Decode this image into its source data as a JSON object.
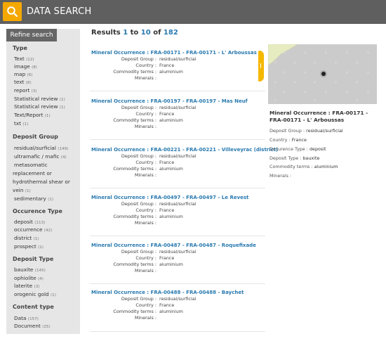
{
  "header": {
    "title": "DATA SEARCH"
  },
  "sidebar": {
    "refine_label": "Refine search",
    "facets": [
      {
        "title": "Type",
        "items": [
          {
            "label": "Text",
            "count": "(12)"
          },
          {
            "label": "image",
            "count": "(8)"
          },
          {
            "label": "map",
            "count": "(6)"
          },
          {
            "label": "text",
            "count": "(8)"
          },
          {
            "label": "report",
            "count": "(3)"
          },
          {
            "label": "Statistical review",
            "count": "(1)"
          },
          {
            "label": "Statistical review",
            "count": "(1)"
          },
          {
            "label": "Text/Report",
            "count": "(1)"
          },
          {
            "label": "txt",
            "count": "(1)"
          }
        ]
      },
      {
        "title": "Deposit Group",
        "items": [
          {
            "label": "residual/surficial",
            "count": "(149)"
          },
          {
            "label": "ultramafic / mafic",
            "count": "(4)"
          },
          {
            "label": "metasomatic",
            "count": ""
          },
          {
            "label": "replacement or",
            "count": ""
          },
          {
            "label": "hydrothermal shear or",
            "count": ""
          },
          {
            "label": "vein",
            "count": "(1)"
          },
          {
            "label": "sedimentary",
            "count": "(1)"
          }
        ]
      },
      {
        "title": "Occurence Type",
        "items": [
          {
            "label": "deposit",
            "count": "(113)"
          },
          {
            "label": "occurrence",
            "count": "(42)"
          },
          {
            "label": "district",
            "count": "(1)"
          },
          {
            "label": "prospect",
            "count": "(1)"
          }
        ]
      },
      {
        "title": "Deposit Type",
        "items": [
          {
            "label": "bauxite",
            "count": "(145)"
          },
          {
            "label": "ophiolite",
            "count": "(4)"
          },
          {
            "label": "laterite",
            "count": "(3)"
          },
          {
            "label": "orogenic gold",
            "count": "(1)"
          }
        ]
      },
      {
        "title": "Content type",
        "items": [
          {
            "label": "Data",
            "count": "(157)"
          },
          {
            "label": "Document",
            "count": "(25)"
          }
        ]
      }
    ]
  },
  "results_header": {
    "prefix": "Results ",
    "from": "1",
    "to_word": " to ",
    "to": "10",
    "of_word": " of ",
    "total": "182"
  },
  "field_labels": {
    "deposit_group": "Deposit Group :",
    "country": "Country :",
    "commodity": "Commodity terms :",
    "minerals": "Minerals :"
  },
  "results": [
    {
      "title": "Mineral Occurrence : FRA-00171 - FRA-00171 - L' Arboussas",
      "deposit_group": "residual/surficial",
      "country": "France",
      "commodity": "aluminium",
      "minerals": ""
    },
    {
      "title": "Mineral Occurrence : FRA-00197 - FRA-00197 - Mas Neuf",
      "deposit_group": "residual/surficial",
      "country": "France",
      "commodity": "aluminium",
      "minerals": ""
    },
    {
      "title": "Mineral Occurrence : FRA-00221 - FRA-00221 - Villeveyrac (district)",
      "deposit_group": "residual/surficial",
      "country": "France",
      "commodity": "aluminium",
      "minerals": ""
    },
    {
      "title": "Mineral Occurrence : FRA-00497 - FRA-00497 - Le Revest",
      "deposit_group": "residual/surficial",
      "country": "France",
      "commodity": "aluminium",
      "minerals": ""
    },
    {
      "title": "Mineral Occurrence : FRA-00487 - FRA-00487 - Roquefixade",
      "deposit_group": "residual/surficial",
      "country": "France",
      "commodity": "aluminium",
      "minerals": ""
    },
    {
      "title": "Mineral Occurrence : FRA-00488 - FRA-00488 - Baychet",
      "deposit_group": "residual/surficial",
      "country": "France",
      "commodity": "aluminium",
      "minerals": ""
    }
  ],
  "detail": {
    "title": "Mineral Occurrence : FRA-00171 - FRA-00171 - L' Arboussas",
    "fields": [
      {
        "label": "Deposit Group :",
        "value": "residual/surficial"
      },
      {
        "label": "Country :",
        "value": "France"
      },
      {
        "label": "Occurence Type :",
        "value": "deposit"
      },
      {
        "label": "Deposit Type :",
        "value": "bauxite"
      },
      {
        "label": "Commodity terms :",
        "value": "aluminium"
      },
      {
        "label": "Minerals :",
        "value": ""
      }
    ]
  },
  "colors": {
    "accent": "#f5a800",
    "link": "#2a7ab0",
    "header": "#5f5f5f",
    "sidebar": "#e6e6e6"
  },
  "icons": {
    "search": "search-icon",
    "collapse": "collapse-handle-icon",
    "map_marker": "location-marker-icon"
  }
}
